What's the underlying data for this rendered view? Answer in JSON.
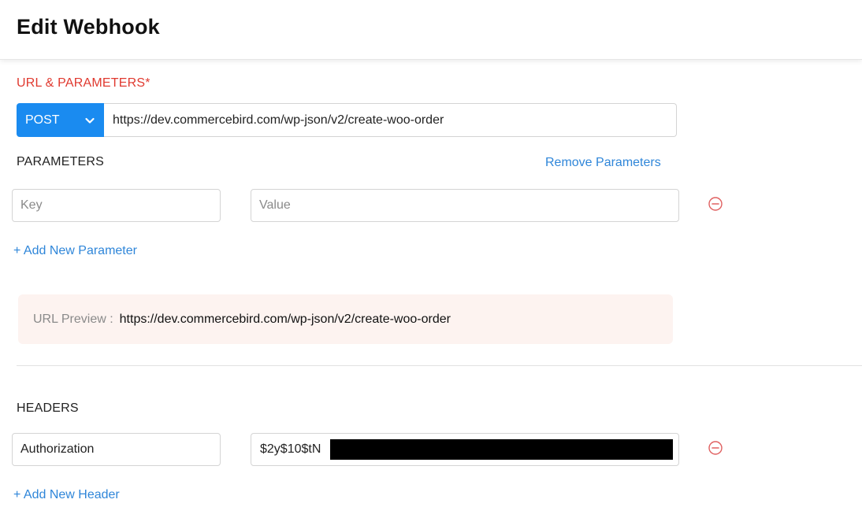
{
  "header": {
    "title": "Edit Webhook"
  },
  "url_section": {
    "label": "URL & PARAMETERS*",
    "method": "POST",
    "url": "https://dev.commercebird.com/wp-json/v2/create-woo-order"
  },
  "parameters": {
    "label": "PARAMETERS",
    "remove_label": "Remove Parameters",
    "key_placeholder": "Key",
    "value_placeholder": "Value",
    "add_label": "+ Add New Parameter"
  },
  "preview": {
    "label": "URL Preview :",
    "value": "https://dev.commercebird.com/wp-json/v2/create-woo-order"
  },
  "headers": {
    "label": "HEADERS",
    "key": "Authorization",
    "value_visible": "$2y$10$tN",
    "add_label": "+ Add New Header"
  },
  "colors": {
    "accent": "#1a8bf0",
    "link": "#2f86d9",
    "required": "#e0392f",
    "remove": "#e06060",
    "preview_bg": "#fdf3f0"
  }
}
